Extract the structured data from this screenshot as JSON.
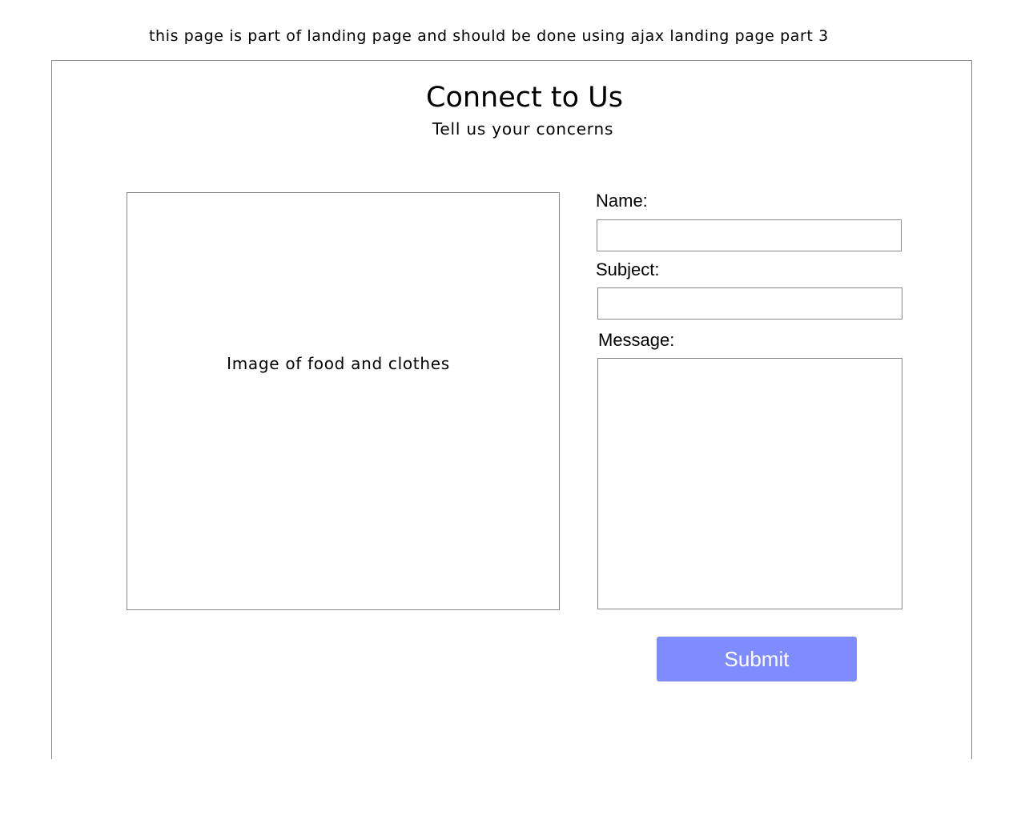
{
  "annotation": {
    "note": "this page is part of landing page and should be done using ajax landing page part 3"
  },
  "header": {
    "title": "Connect to Us",
    "subtitle": "Tell us your concerns"
  },
  "image_placeholder": {
    "caption": "Image of food and clothes"
  },
  "form": {
    "name_label": "Name:",
    "name_value": "",
    "subject_label": "Subject:",
    "subject_value": "",
    "message_label": "Message:",
    "message_value": "",
    "submit_label": "Submit"
  },
  "colors": {
    "submit_button": "#7f8cff",
    "border": "#8a8a8a"
  }
}
